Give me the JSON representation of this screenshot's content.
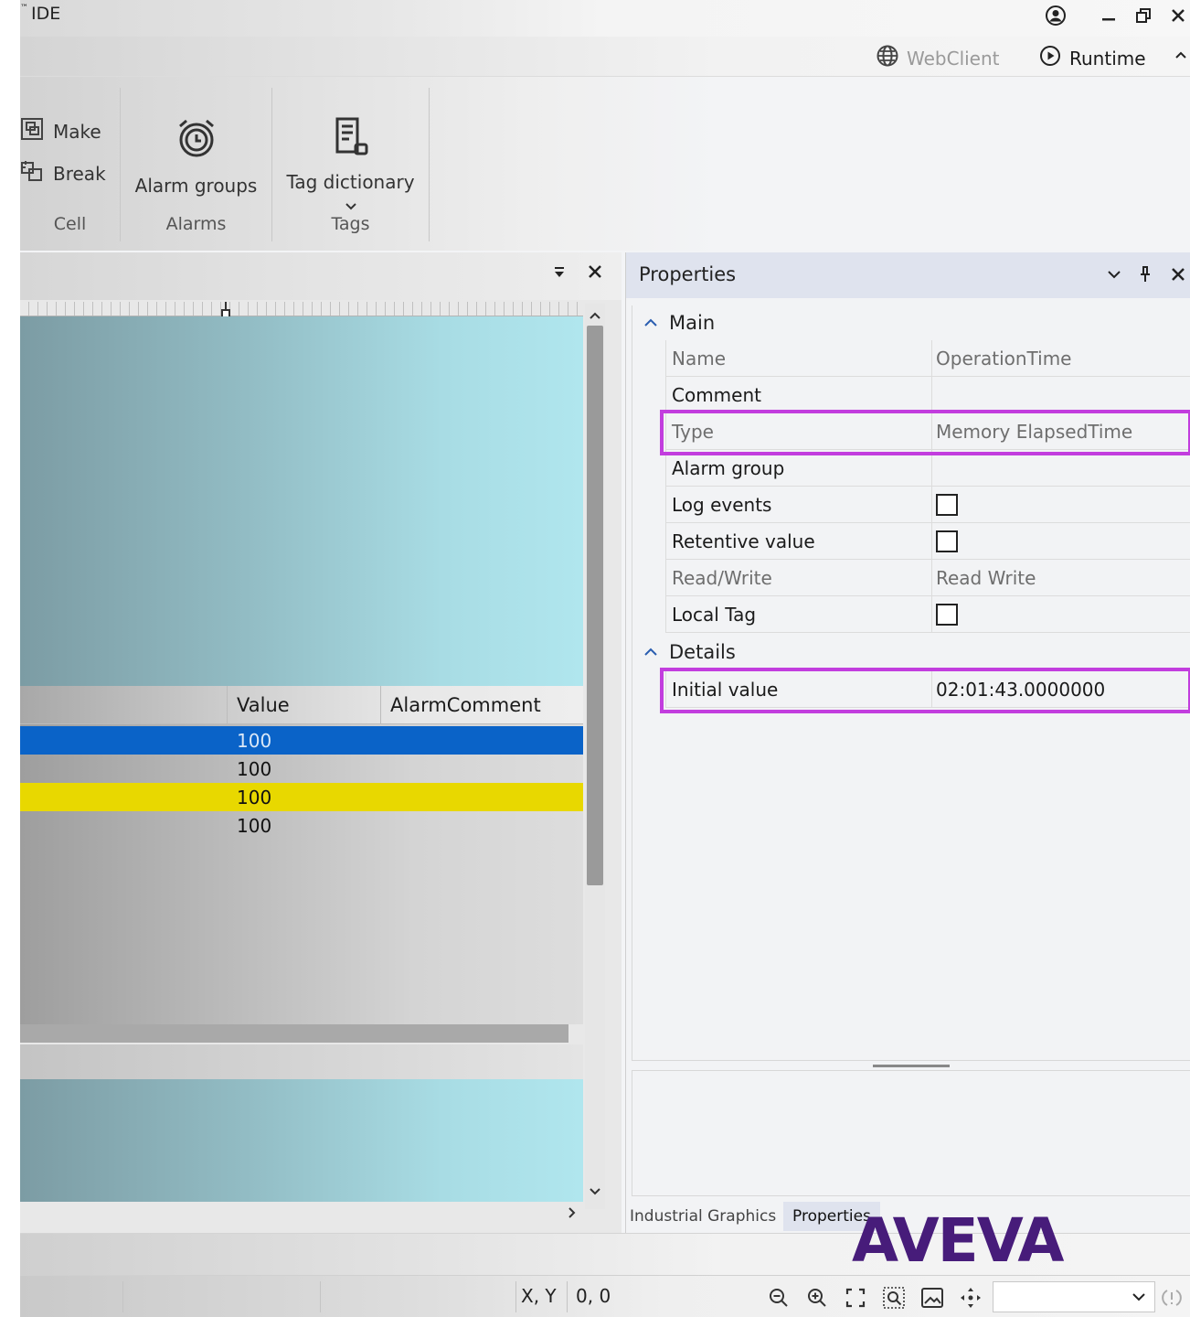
{
  "window": {
    "title": "IDE",
    "title_sup": "™"
  },
  "commands": {
    "webclient_label": "WebClient",
    "runtime_label": "Runtime"
  },
  "ribbon": {
    "cell": {
      "make_label": "Make",
      "break_label": "Break",
      "group_label": "Cell"
    },
    "alarms": {
      "alarm_groups_label": "Alarm groups",
      "group_label": "Alarms"
    },
    "tags": {
      "tag_dictionary_label": "Tag dictionary",
      "group_label": "Tags"
    }
  },
  "grid": {
    "columns": [
      "Value",
      "AlarmComment"
    ],
    "rows": [
      {
        "value": "100",
        "bg": "#0a63c8",
        "fg": "#dbe8f7"
      },
      {
        "value": "100",
        "bg": "transparent",
        "fg": "#111111"
      },
      {
        "value": "100",
        "bg": "#e8d800",
        "fg": "#111111"
      },
      {
        "value": "100",
        "bg": "transparent",
        "fg": "#111111"
      }
    ]
  },
  "properties": {
    "title": "Properties",
    "sections": {
      "main": "Main",
      "details": "Details"
    },
    "rows": {
      "name": {
        "key": "Name",
        "value": "OperationTime"
      },
      "comment": {
        "key": "Comment",
        "value": ""
      },
      "type": {
        "key": "Type",
        "value": "Memory ElapsedTime"
      },
      "alarm_group": {
        "key": "Alarm group",
        "value": ""
      },
      "log_events": {
        "key": "Log events",
        "checked": false
      },
      "retentive_value": {
        "key": "Retentive value",
        "checked": false
      },
      "read_write": {
        "key": "Read/Write",
        "value": "Read Write"
      },
      "local_tag": {
        "key": "Local Tag",
        "checked": false
      },
      "initial_value": {
        "key": "Initial value",
        "value": "02:01:43.0000000"
      }
    },
    "highlight_color": "#c23dde",
    "tabs": [
      "Industrial Graphics",
      "Properties"
    ],
    "active_tab": "Properties"
  },
  "statusbar": {
    "xy_label": "X, Y",
    "xy_value": "0, 0",
    "zoom_value": ""
  },
  "logo": {
    "text": "AVEVA",
    "color": "#471c7a"
  }
}
